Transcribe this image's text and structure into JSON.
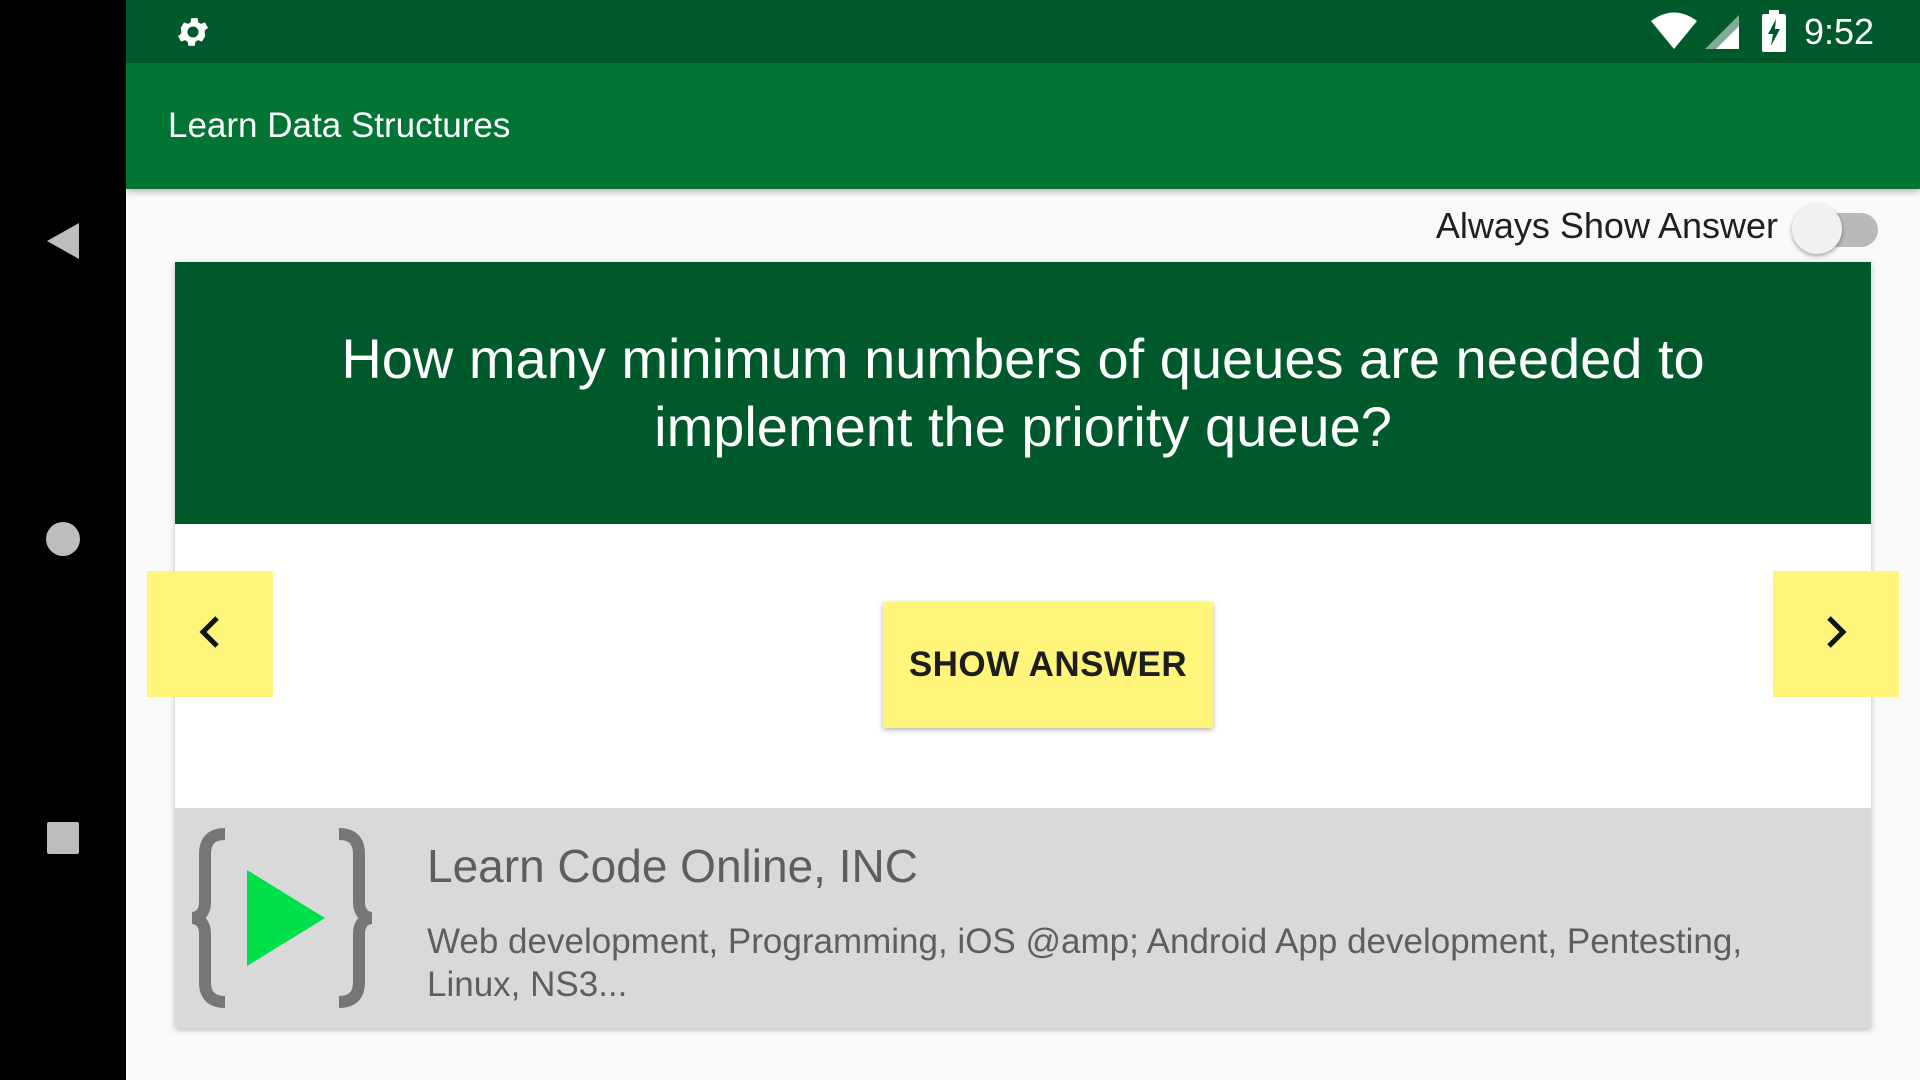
{
  "status_bar": {
    "time": "9:52",
    "icons": [
      "settings-icon",
      "wifi-icon",
      "cell-signal-icon",
      "battery-charging-icon"
    ]
  },
  "nav_bar": {
    "icons": [
      "back-triangle-icon",
      "home-circle-icon",
      "recents-square-icon"
    ]
  },
  "toolbar": {
    "title": "Learn Data Structures"
  },
  "toggle": {
    "label": "Always Show Answer",
    "checked": false
  },
  "question": {
    "text": "How many minimum numbers of queues are needed to implement the priority queue?"
  },
  "actions": {
    "show_answer_label": "SHOW ANSWER",
    "prev_icon": "chevron-left-icon",
    "next_icon": "chevron-right-icon"
  },
  "ad": {
    "title": "Learn Code Online, INC",
    "description": "Web development, Programming, iOS @amp; Android App development, Pentesting, Linux, NS3...",
    "logo_icon": "code-braces-play-icon"
  },
  "colors": {
    "status_bar": "#00592a",
    "toolbar": "#027534",
    "question_bg": "#00592a",
    "button_yellow": "#fff57a",
    "ad_bg": "#d9d9d9",
    "logo_green": "#00e04b"
  }
}
